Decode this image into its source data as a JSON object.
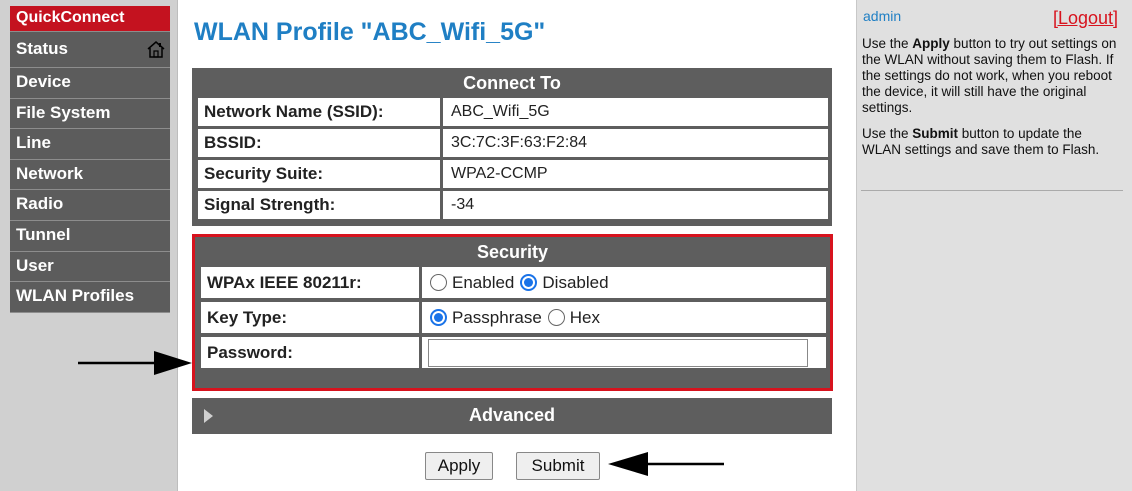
{
  "sidebar": {
    "items": [
      {
        "label": "QuickConnect"
      },
      {
        "label": "Status"
      },
      {
        "label": "Device"
      },
      {
        "label": "File System"
      },
      {
        "label": "Line"
      },
      {
        "label": "Network"
      },
      {
        "label": "Radio"
      },
      {
        "label": "Tunnel"
      },
      {
        "label": "User"
      },
      {
        "label": "WLAN Profiles"
      }
    ],
    "active_color": "#c4121f"
  },
  "page": {
    "title": "WLAN Profile \"ABC_Wifi_5G\""
  },
  "connect": {
    "header": "Connect To",
    "rows": [
      {
        "label": "Network Name (SSID):",
        "value": "ABC_Wifi_5G"
      },
      {
        "label": "BSSID:",
        "value": "3C:7C:3F:63:F2:84"
      },
      {
        "label": "Security Suite:",
        "value": "WPA2-CCMP"
      },
      {
        "label": "Signal Strength:",
        "value": "-34"
      }
    ]
  },
  "security": {
    "header": "Security",
    "wpax_label": "WPAx IEEE 80211r:",
    "wpax_options": {
      "enabled": "Enabled",
      "disabled": "Disabled"
    },
    "wpax_selected": "Disabled",
    "keytype_label": "Key Type:",
    "keytype_options": {
      "passphrase": "Passphrase",
      "hex": "Hex"
    },
    "keytype_selected": "Passphrase",
    "password_label": "Password:",
    "password_value": "",
    "outline_color": "#d7131e"
  },
  "advanced": {
    "header": "Advanced"
  },
  "buttons": {
    "apply": "Apply",
    "submit": "Submit"
  },
  "help": {
    "user": "admin",
    "logout": "[Logout]",
    "p1_pre": "Use the ",
    "p1_bold": "Apply",
    "p1_post": " button to try out settings on the WLAN without saving them to Flash. If the settings do not work, when you reboot the device, it will still have the original settings.",
    "p2_pre": "Use the ",
    "p2_bold": "Submit",
    "p2_post": " button to update the WLAN settings and save them to Flash."
  },
  "icons": {
    "home": "home-icon",
    "expand": "triangle-right-icon",
    "pointer": "arrow-right-icon",
    "pointer_left": "arrow-left-icon"
  },
  "colors": {
    "title": "#1f7fc4",
    "section": "#5e5e5e",
    "radio_selected": "#1a73e8"
  }
}
